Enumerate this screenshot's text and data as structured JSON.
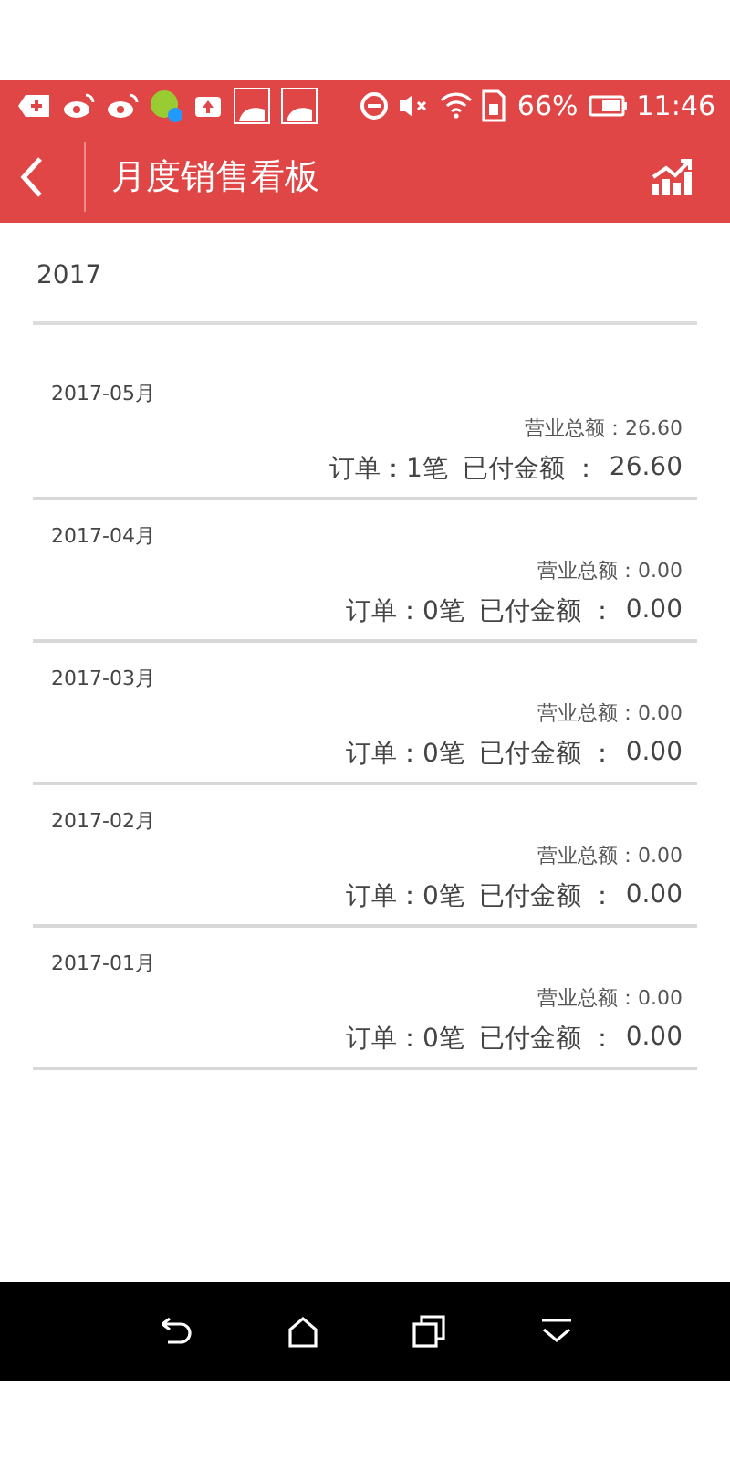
{
  "status_bar": {
    "battery": "66%",
    "time": "11:46"
  },
  "header": {
    "title": "月度销售看板"
  },
  "year": "2017",
  "months": [
    {
      "month": "2017-05月",
      "total": "营业总额：26.60",
      "orders": "订单：1笔",
      "paid_label": "已付金额 ：",
      "paid": "26.60"
    },
    {
      "month": "2017-04月",
      "total": "营业总额：0.00",
      "orders": "订单：0笔",
      "paid_label": "已付金额 ：",
      "paid": "0.00"
    },
    {
      "month": "2017-03月",
      "total": "营业总额：0.00",
      "orders": "订单：0笔",
      "paid_label": "已付金额 ：",
      "paid": "0.00"
    },
    {
      "month": "2017-02月",
      "total": "营业总额：0.00",
      "orders": "订单：0笔",
      "paid_label": "已付金额 ：",
      "paid": "0.00"
    },
    {
      "month": "2017-01月",
      "total": "营业总额：0.00",
      "orders": "订单：0笔",
      "paid_label": "已付金额 ：",
      "paid": "0.00"
    }
  ]
}
